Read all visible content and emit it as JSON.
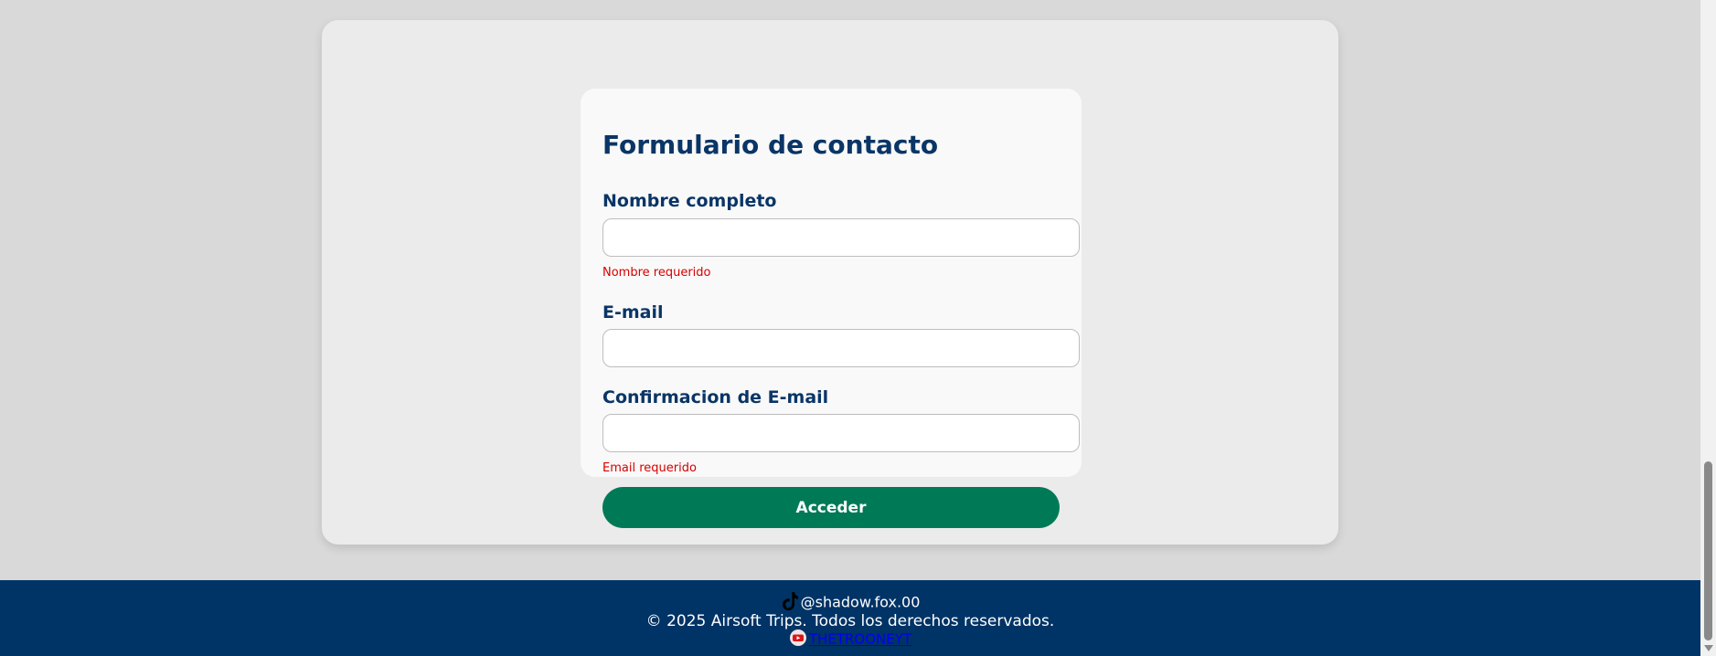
{
  "form": {
    "title": "Formulario de contacto",
    "fields": [
      {
        "label": "Nombre completo",
        "value": "",
        "error": "Nombre requerido"
      },
      {
        "label": "E-mail",
        "value": "",
        "error": ""
      },
      {
        "label": "Confirmacion de E-mail",
        "value": "",
        "error": "Email requerido"
      }
    ],
    "submit_label": "Acceder"
  },
  "footer": {
    "tiktok_handle": "@shadow.fox.00",
    "copyright": "© 2025 Airsoft Trips. Todos los derechos reservados.",
    "youtube_link_text": "THETROONEYT"
  },
  "colors": {
    "page_background": "#d9d9d9",
    "primary_text": "#0a3566",
    "error": "#d80000",
    "button": "#007a56",
    "footer_background": "#003366"
  },
  "icons": {
    "tiktok": "tiktok-icon",
    "youtube": "youtube-icon"
  }
}
